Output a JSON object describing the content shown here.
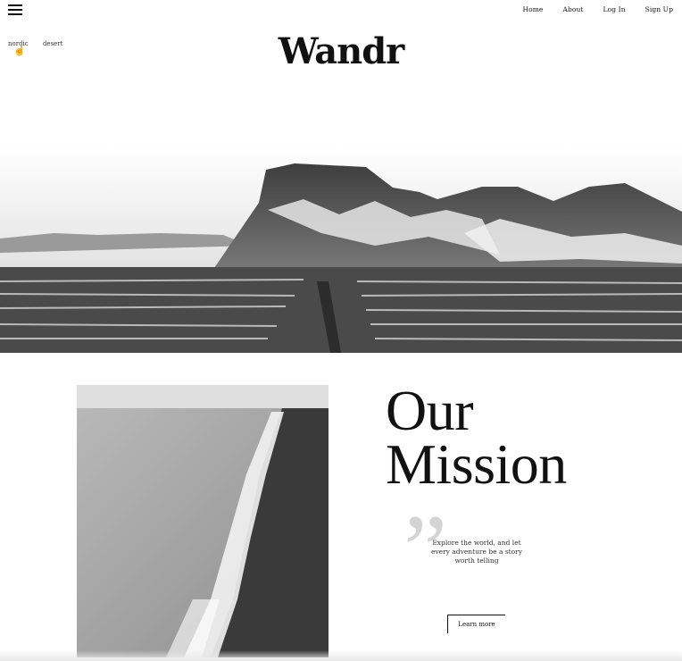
{
  "nav": {
    "links": [
      "Home",
      "About",
      "Log In",
      "Sign Up"
    ]
  },
  "filters": {
    "chips": [
      "nordic",
      "desert"
    ]
  },
  "brand": {
    "logo": "Wandr"
  },
  "hero": {
    "image_alt": "mountain-landscape"
  },
  "mission": {
    "title_line1": "Our",
    "title_line2": "Mission",
    "quote": "Explore the world, and let every adventure be a story worth telling",
    "button": "Learn more"
  },
  "colors": {
    "text": "#111111",
    "quote_mark": "#d4d4d4",
    "background": "#ffffff"
  }
}
